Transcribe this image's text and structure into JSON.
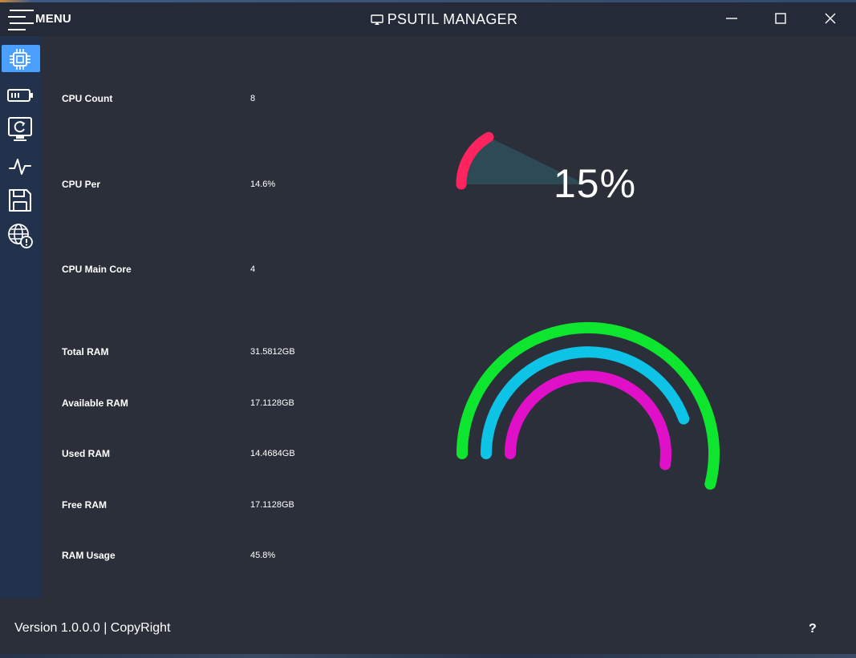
{
  "window": {
    "title": "PSUTIL MANAGER",
    "title_icon": "monitor-cast-icon",
    "menu_label": "MENU",
    "controls": [
      "minimize-icon",
      "maximize-icon",
      "close-icon"
    ]
  },
  "sidebar": {
    "items": [
      {
        "name": "cpu",
        "icon": "cpu-chip-icon",
        "active": true
      },
      {
        "name": "battery",
        "icon": "battery-icon",
        "active": false
      },
      {
        "name": "system",
        "icon": "monitor-refresh-icon",
        "active": false
      },
      {
        "name": "activity",
        "icon": "pulse-icon",
        "active": false
      },
      {
        "name": "storage",
        "icon": "floppy-disk-icon",
        "active": false
      },
      {
        "name": "network",
        "icon": "globe-alert-icon",
        "active": false
      }
    ]
  },
  "info": {
    "rows": [
      {
        "label": "CPU Count",
        "value": "8"
      },
      {
        "label": "CPU Per",
        "value": "14.6%"
      },
      {
        "label": "CPU Main Core",
        "value": "4"
      },
      {
        "label": "Total RAM",
        "value": "31.5812GB"
      },
      {
        "label": "Available RAM",
        "value": "17.1128GB"
      },
      {
        "label": "Used RAM",
        "value": "14.4684GB"
      },
      {
        "label": "Free RAM",
        "value": "17.1128GB"
      },
      {
        "label": "RAM Usage",
        "value": "45.8%"
      }
    ]
  },
  "cpu_gauge": {
    "percent_text": "15%",
    "value_percent": 14.6,
    "arc_color": "#ff2360",
    "fill_color": "#2e4a54"
  },
  "ram_gauge": {
    "rings": [
      {
        "name": "outer",
        "color": "#0ee52f",
        "fraction": 0.58
      },
      {
        "name": "middle",
        "color": "#0dc4e6",
        "fraction": 0.38
      },
      {
        "name": "inner",
        "color": "#e010c8",
        "fraction": 0.55
      }
    ]
  },
  "footer": {
    "version_text": "Version 1.0.0.0 | CopyRight",
    "help_label": "?"
  }
}
